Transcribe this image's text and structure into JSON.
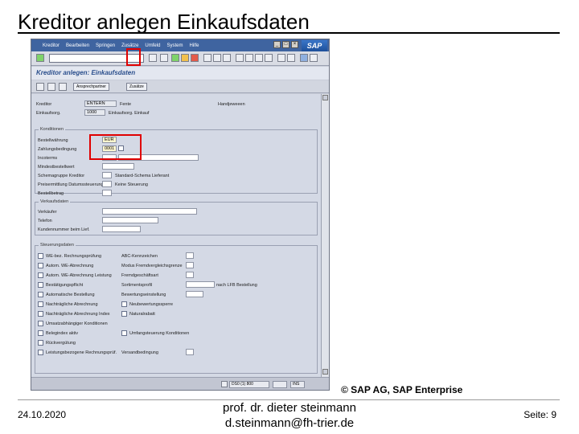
{
  "slide": {
    "title": "Kreditor anlegen Einkaufsdaten",
    "copyright": "© SAP AG, SAP Enterprise",
    "date": "24.10.2020",
    "author_line1": "prof. dr. dieter steinmann",
    "author_line2": "d.steinmann@fh-trier.de",
    "page": "Seite: 9"
  },
  "sap": {
    "menu": [
      "Kreditor",
      "Bearbeiten",
      "Springen",
      "Zusätze",
      "Umfeld",
      "System",
      "Hilfe"
    ],
    "logo": "SAP",
    "screen_title": "Kreditor anlegen: Einkaufsdaten",
    "app_buttons": [
      "Ansprechpartner",
      "Zusätze"
    ],
    "header": {
      "kreditor_label": "Kreditor",
      "kreditor_value": "ENTERN",
      "name_label": "Fente",
      "ort_label": "Handjeweeen",
      "einkorg_label": "Einkaufsorg.",
      "einkorg_value": "1000",
      "einkorg_text": "Einkaufsorg. Einkauf"
    },
    "konditionen": {
      "title": "Konditionen",
      "rows": [
        {
          "label": "Bestellwährung",
          "value": "EUR"
        },
        {
          "label": "Zahlungsbedingung",
          "value": "0001"
        },
        {
          "label": "Incoterms",
          "value": ""
        },
        {
          "label": "Mindestbestellwert",
          "value": ""
        },
        {
          "label": "Schemagruppe Kreditor",
          "value": ""
        },
        {
          "label": "Preisermittlung Datumssteuerung",
          "value": ""
        },
        {
          "label": "Bestellbetrag",
          "value": ""
        }
      ],
      "right_labels": [
        "Standard-Schema Lieferant",
        "Keine Steuerung"
      ]
    },
    "verkauf": {
      "title": "Verkaufsdaten",
      "rows": [
        {
          "label": "Verkäufer"
        },
        {
          "label": "Telefon"
        },
        {
          "label": "Kundennummer beim Lief."
        }
      ]
    },
    "steuerung": {
      "title": "Steuerungsdaten",
      "left": [
        "WE-bez. Rechnungsprüfung",
        "Autom. WE-Abrechnung",
        "Autom. WE-Abrechnung Leistung",
        "Bestätigungspflicht",
        "Automatische Bestellung",
        "Nachträgliche Abrechnung",
        "Nachträgliche Abrechnung Index",
        "Umsatzabhängiger Konditionen",
        "Belegindex aktiv",
        "Rückvergütung",
        "Leistungsbezogene Rechnungsprüf."
      ],
      "right": [
        "ABC-Kennzeichen",
        "Modus Fremdvergleichsgrenze",
        "Fremdgeschäftsart",
        "Sortimentsprofil",
        "Bewertungseinstellung",
        "Neubewertungssperre",
        "Naturalrabatt",
        "",
        "Umfangsteuerung Konditionen",
        "Versandbedingung"
      ],
      "extra_label": "nach LFB Bestellung"
    },
    "status": {
      "system": "DS0 (1) 800",
      "mode": "INS"
    }
  }
}
